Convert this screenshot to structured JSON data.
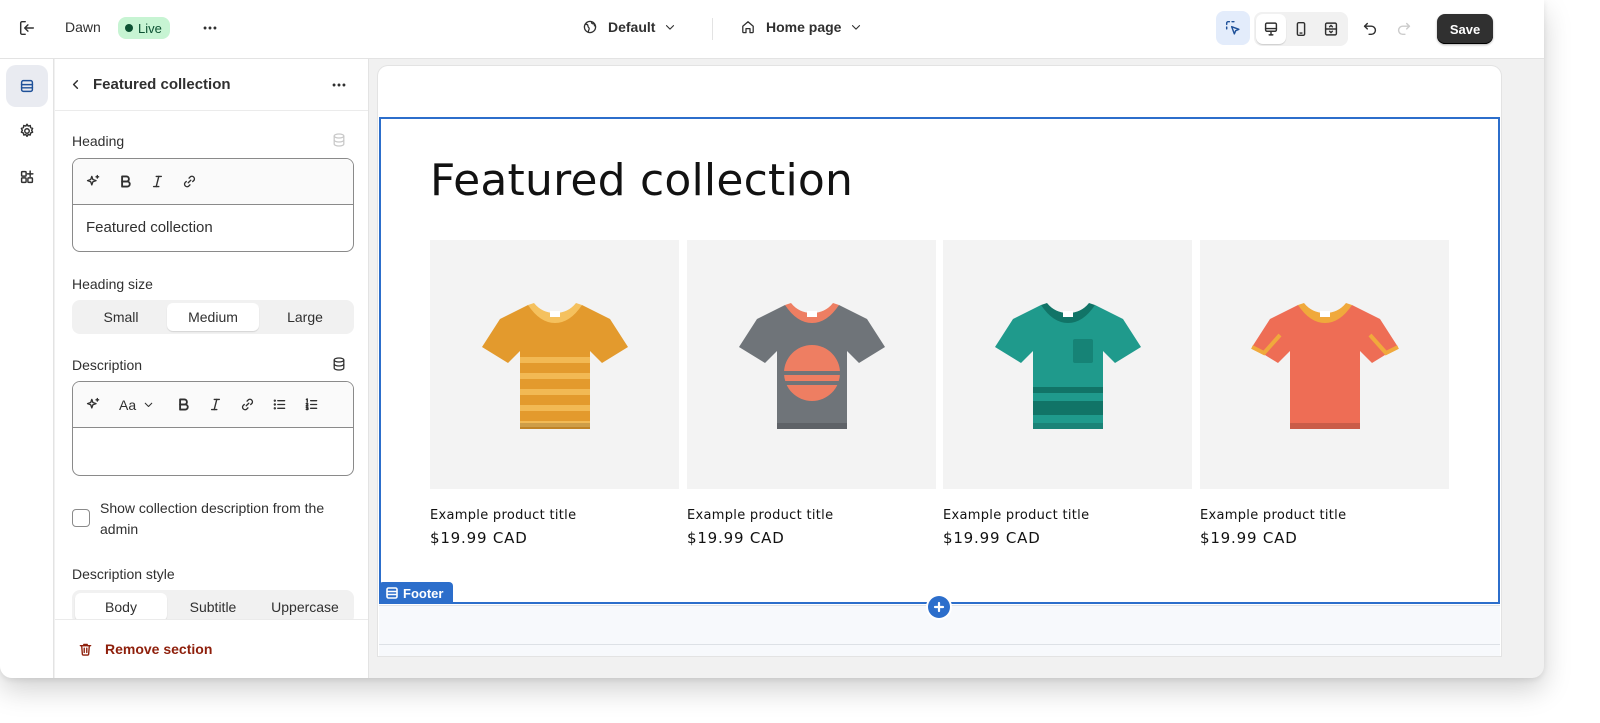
{
  "topbar": {
    "theme_name": "Dawn",
    "live_badge": "Live",
    "theme_selector": "Default",
    "page_selector": "Home page",
    "save_label": "Save"
  },
  "panel": {
    "title": "Featured collection",
    "heading_label": "Heading",
    "heading_value": "Featured collection",
    "heading_size_label": "Heading size",
    "heading_sizes": [
      "Small",
      "Medium",
      "Large"
    ],
    "heading_size_selected": "Medium",
    "description_label": "Description",
    "description_value": "",
    "font_tool_label": "Aa",
    "show_description_label": "Show collection description from the admin",
    "show_description_checked": false,
    "description_style_label": "Description style",
    "description_styles": [
      "Body",
      "Subtitle",
      "Uppercase"
    ],
    "description_style_selected": "Body",
    "remove_label": "Remove section"
  },
  "preview": {
    "section_title": "Featured collection",
    "footer_tag": "Footer",
    "products": [
      {
        "title": "Example product title",
        "price": "$19.99 CAD",
        "color": "#e39a2d",
        "accent": "#f5c15e"
      },
      {
        "title": "Example product title",
        "price": "$19.99 CAD",
        "color": "#6f7479",
        "accent": "#ee7e62"
      },
      {
        "title": "Example product title",
        "price": "$19.99 CAD",
        "color": "#1f9a8c",
        "accent": "#117467"
      },
      {
        "title": "Example product title",
        "price": "$19.99 CAD",
        "color": "#ee6d55",
        "accent": "#f0a93c"
      }
    ]
  },
  "colors": {
    "selection": "#2c6ecb",
    "danger": "#8e1f0b",
    "live_bg": "#c7f4d3"
  }
}
